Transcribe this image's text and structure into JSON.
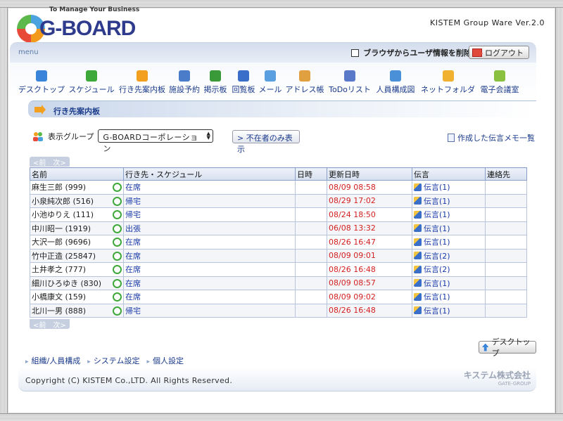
{
  "brand": {
    "tagline": "To Manage Your Business",
    "logo_text": "G-BOARD",
    "version": "KISTEM Group Ware Ver.2.0"
  },
  "menu": {
    "label": "menu",
    "clear_user_label": "ブラウザからユーザ情報を削除",
    "logout_label": "ログアウト",
    "items": [
      {
        "label": "デスクトップ",
        "icon": "up-arrow-icon",
        "color": "#3a84d9"
      },
      {
        "label": "スケジュール",
        "icon": "alarm-clock-icon",
        "color": "#3fa83a"
      },
      {
        "label": "行き先案内板",
        "icon": "arrow-sign-icon",
        "color": "#f3a020"
      },
      {
        "label": "施設予約",
        "icon": "building-icon",
        "color": "#4a7cc9"
      },
      {
        "label": "掲示板",
        "icon": "board-icon",
        "color": "#3a9a3a"
      },
      {
        "label": "回覧板",
        "icon": "checklist-icon",
        "color": "#3a6fc9"
      },
      {
        "label": "メール",
        "icon": "mail-icon",
        "color": "#5aa0e0"
      },
      {
        "label": "アドレス帳",
        "icon": "address-book-icon",
        "color": "#e0a040"
      },
      {
        "label": "ToDoリスト",
        "icon": "todo-icon",
        "color": "#5a7ac9"
      },
      {
        "label": "人員構成図",
        "icon": "org-chart-icon",
        "color": "#4a90d9"
      },
      {
        "label": "ネットフォルダ",
        "icon": "folder-icon",
        "color": "#f0b030"
      },
      {
        "label": "電子会議室",
        "icon": "chat-icon",
        "color": "#8ac040"
      }
    ]
  },
  "section": {
    "title": "行き先案内板"
  },
  "controls": {
    "group_label": "表示グループ",
    "group_value": "G-BOARDコーポレーション",
    "absent_only_label": "不在者のみ表示",
    "memo_list_label": "作成した伝言メモ一覧"
  },
  "pager": {
    "prev": "前",
    "next": "次"
  },
  "table": {
    "headers": [
      "名前",
      "行き先・スケジュール",
      "日時",
      "更新日時",
      "伝言",
      "連絡先"
    ],
    "rows": [
      {
        "name": "麻生三郎 (999)",
        "status": "在席",
        "datetime": "",
        "updated": "08/09 08:58",
        "message": "伝言(1)",
        "contact": ""
      },
      {
        "name": "小泉純次郎 (516)",
        "status": "帰宅",
        "datetime": "",
        "updated": "08/29 17:02",
        "message": "伝言(1)",
        "contact": ""
      },
      {
        "name": "小池ゆりえ (111)",
        "status": "帰宅",
        "datetime": "",
        "updated": "08/24 18:50",
        "message": "伝言(1)",
        "contact": ""
      },
      {
        "name": "中川昭一 (1919)",
        "status": "出張",
        "datetime": "",
        "updated": "06/08 13:32",
        "message": "伝言(1)",
        "contact": ""
      },
      {
        "name": "大沢一郎 (9696)",
        "status": "在席",
        "datetime": "",
        "updated": "08/26 16:47",
        "message": "伝言(1)",
        "contact": ""
      },
      {
        "name": "竹中正造 (25847)",
        "status": "在席",
        "datetime": "",
        "updated": "08/09 09:01",
        "message": "伝言(2)",
        "contact": ""
      },
      {
        "name": "土井孝之 (777)",
        "status": "在席",
        "datetime": "",
        "updated": "08/26 16:48",
        "message": "伝言(2)",
        "contact": ""
      },
      {
        "name": "細川ひろゆき (830)",
        "status": "在席",
        "datetime": "",
        "updated": "08/09 08:57",
        "message": "伝言(1)",
        "contact": ""
      },
      {
        "name": "小橋康文 (159)",
        "status": "在席",
        "datetime": "",
        "updated": "08/09 09:02",
        "message": "伝言(1)",
        "contact": ""
      },
      {
        "name": "北川一男 (888)",
        "status": "帰宅",
        "datetime": "",
        "updated": "08/26 16:48",
        "message": "伝言(1)",
        "contact": ""
      }
    ]
  },
  "desktop_button": "デスクトップ",
  "footer": {
    "links": [
      "組織/人員構成",
      "システム設定",
      "個人設定"
    ],
    "copyright": "Copyright (C) KISTEM Co.,LTD. All Rights Reserved.",
    "company_name": "キステム株式会社",
    "company_group": "GATE-GROUP"
  }
}
